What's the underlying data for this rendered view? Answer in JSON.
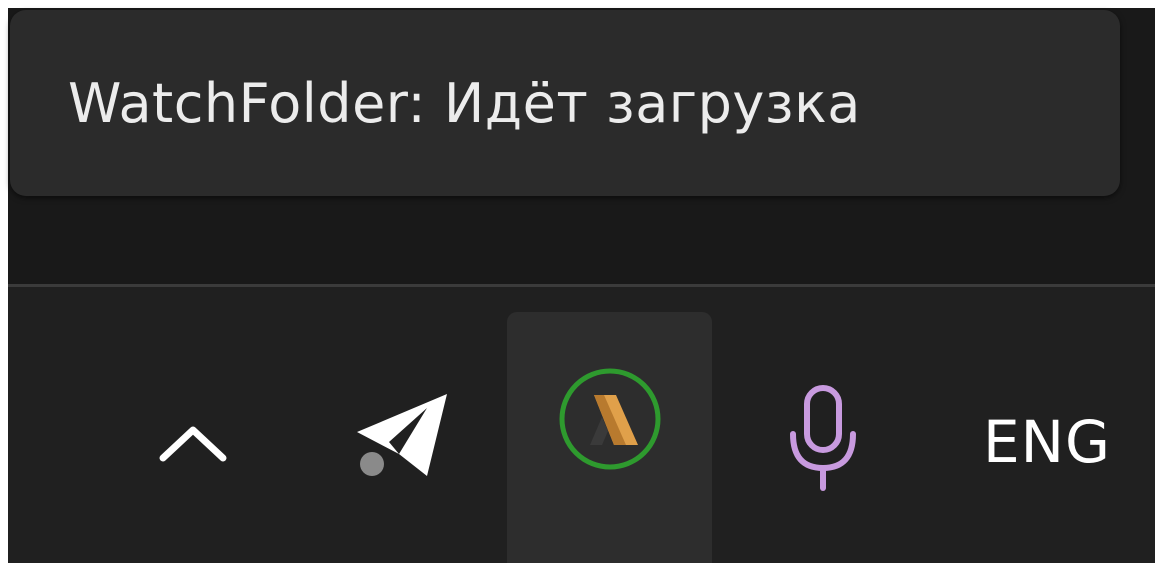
{
  "tooltip": {
    "text": "WatchFolder: Идёт загрузка"
  },
  "tray": {
    "icons": {
      "show_hidden": "chevron-up-icon",
      "telegram": "telegram-icon",
      "watchfolder": "watchfolder-app-icon",
      "microphone": "microphone-icon"
    },
    "language_label": "ENG"
  },
  "colors": {
    "tooltip_bg": "#2b2b2b",
    "taskbar_bg": "#202020",
    "watchfolder_ring": "#2e9a2e",
    "watchfolder_wedge": "#e0a04a",
    "microphone": "#c89adf"
  }
}
